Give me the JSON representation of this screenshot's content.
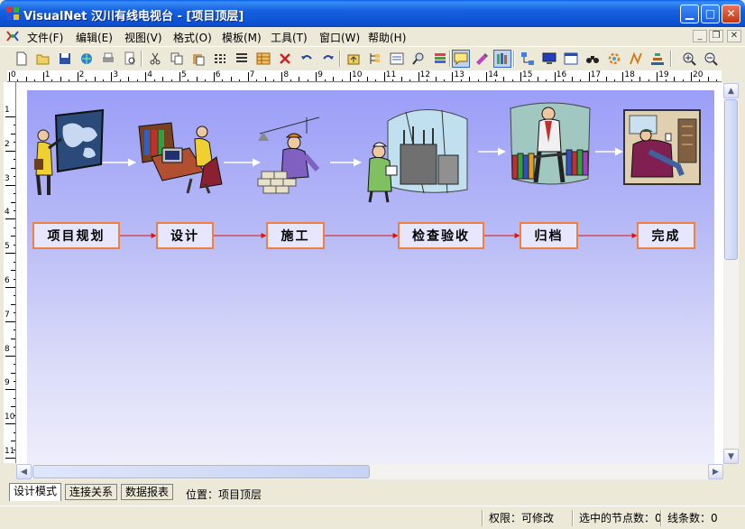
{
  "window": {
    "app_name": "VisualNet",
    "title": "VisualNet 汉川有线电视台 - [项目顶层]"
  },
  "menu": [
    {
      "label": "文件(F)"
    },
    {
      "label": "编辑(E)"
    },
    {
      "label": "视图(V)"
    },
    {
      "label": "格式(O)"
    },
    {
      "label": "模板(M)"
    },
    {
      "label": "工具(T)"
    },
    {
      "label": "窗口(W)"
    },
    {
      "label": "帮助(H)"
    }
  ],
  "toolbar": {
    "icons": [
      "new-icon",
      "open-icon",
      "save-icon",
      "publish-icon",
      "print-icon",
      "print-preview-icon",
      "cut-icon",
      "copy-icon",
      "paste-icon",
      "grid-icon",
      "list-icon",
      "table-icon",
      "delete-icon",
      "undo-icon",
      "redo-icon",
      "up-level-icon",
      "tree-icon",
      "form-icon",
      "find-icon",
      "layers-icon",
      "comment-icon",
      "paint-icon",
      "library-icon",
      "network-icon",
      "monitor-icon",
      "window-icon",
      "binoculars-icon",
      "settings-icon",
      "link-icon",
      "stack-icon",
      "zoom-in-icon",
      "zoom-out-icon"
    ]
  },
  "ruler": {
    "top_numbers": [
      "0",
      "1",
      "2",
      "3",
      "4",
      "5",
      "6",
      "7",
      "8",
      "9",
      "10",
      "11",
      "12",
      "13",
      "14",
      "15",
      "16",
      "17",
      "18",
      "19",
      "20"
    ],
    "left_numbers": [
      "1",
      "2",
      "3",
      "4",
      "5",
      "6",
      "7",
      "8",
      "9",
      "10",
      "11"
    ]
  },
  "diagram": {
    "nodes": [
      {
        "label": "项目规划",
        "picture": "presenter-with-map-picture"
      },
      {
        "label": "设计",
        "picture": "designer-at-computer-picture"
      },
      {
        "label": "施工",
        "picture": "construction-worker-picture"
      },
      {
        "label": "检查验收",
        "picture": "inspector-at-substation-picture"
      },
      {
        "label": "归档",
        "picture": "archivist-with-books-picture"
      },
      {
        "label": "完成",
        "picture": "relaxing-in-armchair-picture"
      }
    ],
    "colors": {
      "node_border": "#f08040",
      "arrow": "#e01010",
      "background_top": "#9b9ef7",
      "background_bottom": "#eeeefb"
    }
  },
  "tabs": [
    {
      "label": "设计模式",
      "active": true
    },
    {
      "label": "连接关系",
      "active": false
    },
    {
      "label": "数据报表",
      "active": false
    }
  ],
  "location": {
    "label": "位置：",
    "value": "项目顶层"
  },
  "status": {
    "permission": "权限：可修改",
    "selected_nodes": "选中的节点数：0",
    "lines": "线条数：0"
  }
}
